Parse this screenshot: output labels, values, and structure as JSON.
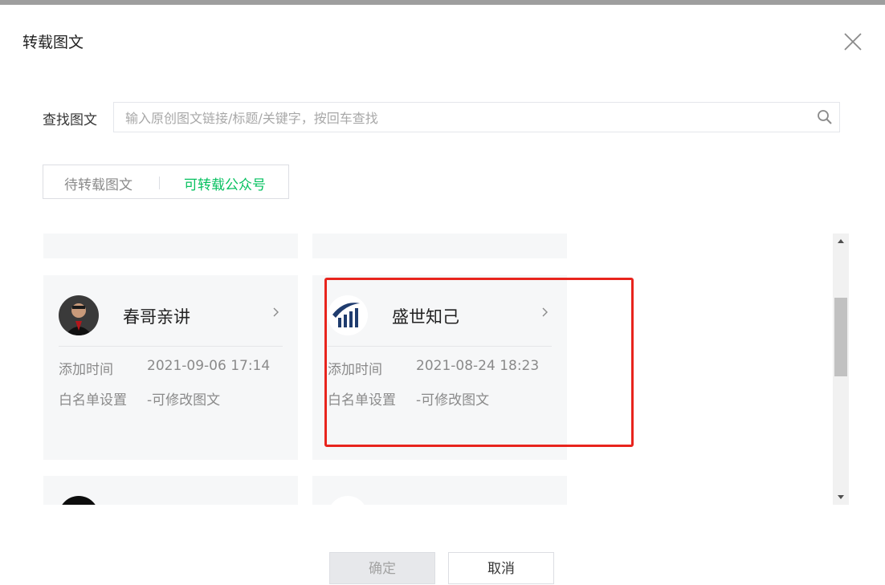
{
  "dialog": {
    "title": "转载图文"
  },
  "search": {
    "label": "查找图文",
    "placeholder": "输入原创图文链接/标题/关键字，按回车查找"
  },
  "tabs": [
    {
      "label": "待转载图文",
      "active": false
    },
    {
      "label": "可转载公众号",
      "active": true
    }
  ],
  "accounts": [
    {
      "name": "春哥亲讲",
      "added_label": "添加时间",
      "added_time": "2021-09-06 17:14",
      "whitelist_label": "白名单设置",
      "whitelist_value": "-可修改图文",
      "avatar_icon": "person-photo-icon"
    },
    {
      "name": "盛世知己",
      "added_label": "添加时间",
      "added_time": "2021-08-24 18:23",
      "whitelist_label": "白名单设置",
      "whitelist_value": "-可修改图文",
      "avatar_icon": "bar-chart-logo-icon"
    }
  ],
  "footer": {
    "confirm_label": "确定",
    "cancel_label": "取消"
  },
  "colors": {
    "accent_green": "#07c160",
    "highlight_red": "#e8241d"
  }
}
